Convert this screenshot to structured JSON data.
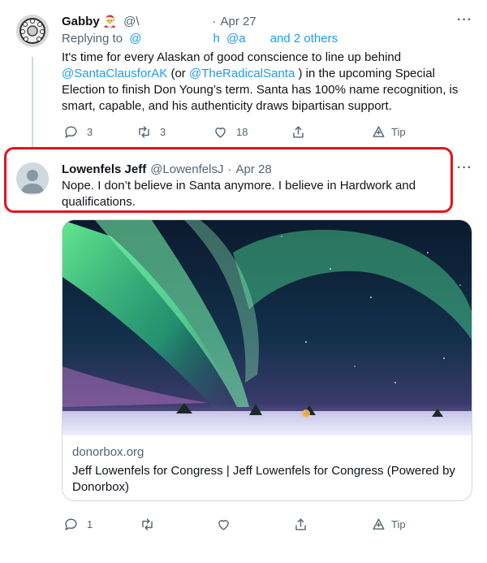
{
  "tweet1": {
    "name": "Gabby",
    "emoji": "🎅",
    "handle": "@\\",
    "sep": "·",
    "date": "Apr 27",
    "replying_prefix": "Replying to",
    "replying_mention1": "@",
    "replying_mention1_tail": "h",
    "replying_mention2": "@a",
    "replying_and": "and 2 others",
    "text_1": "It's time for every Alaskan of good conscience to line up behind",
    "mention_santa": "@SantaClausforAK",
    "text_2": "(or",
    "mention_radical": "@TheRadicalSanta",
    "text_3": ") in the upcoming Special Election to finish Don Young’s term. Santa has 100% name recognition, is smart, capable, and his authenticity draws bipartisan support.",
    "actions": {
      "reply": "3",
      "retweet": "3",
      "like": "18",
      "tip": "Tip"
    }
  },
  "tweet2": {
    "name": "Lowenfels Jeff",
    "handle": "@LowenfelsJ",
    "sep": "·",
    "date": "Apr 28",
    "text": "Nope. I don’t believe in Santa anymore. I believe in Hardwork and qualifications.",
    "card": {
      "domain": "donorbox.org",
      "title": "Jeff Lowenfels for Congress | Jeff Lowenfels for Congress (Powered by Donorbox)"
    },
    "actions": {
      "reply": "1",
      "tip": "Tip"
    }
  },
  "more_glyph": "···",
  "colors": {
    "link": "#1d9bf0",
    "highlight": "#e0141e",
    "muted": "#536471"
  }
}
